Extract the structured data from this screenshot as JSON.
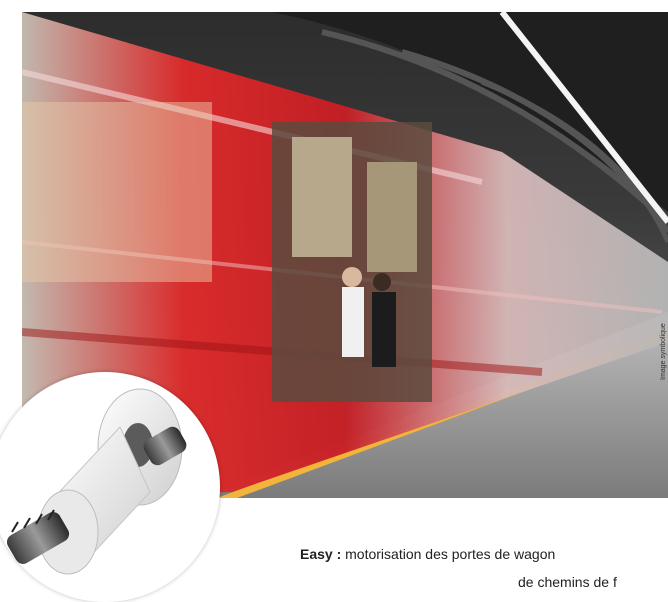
{
  "caption": {
    "bold": "Easy :",
    "line1": " motorisation des portes de wagon",
    "line2": "de chemins de f"
  },
  "credit": "Image symbolique",
  "icons": [
    "train-photo",
    "bearing-product-image"
  ]
}
